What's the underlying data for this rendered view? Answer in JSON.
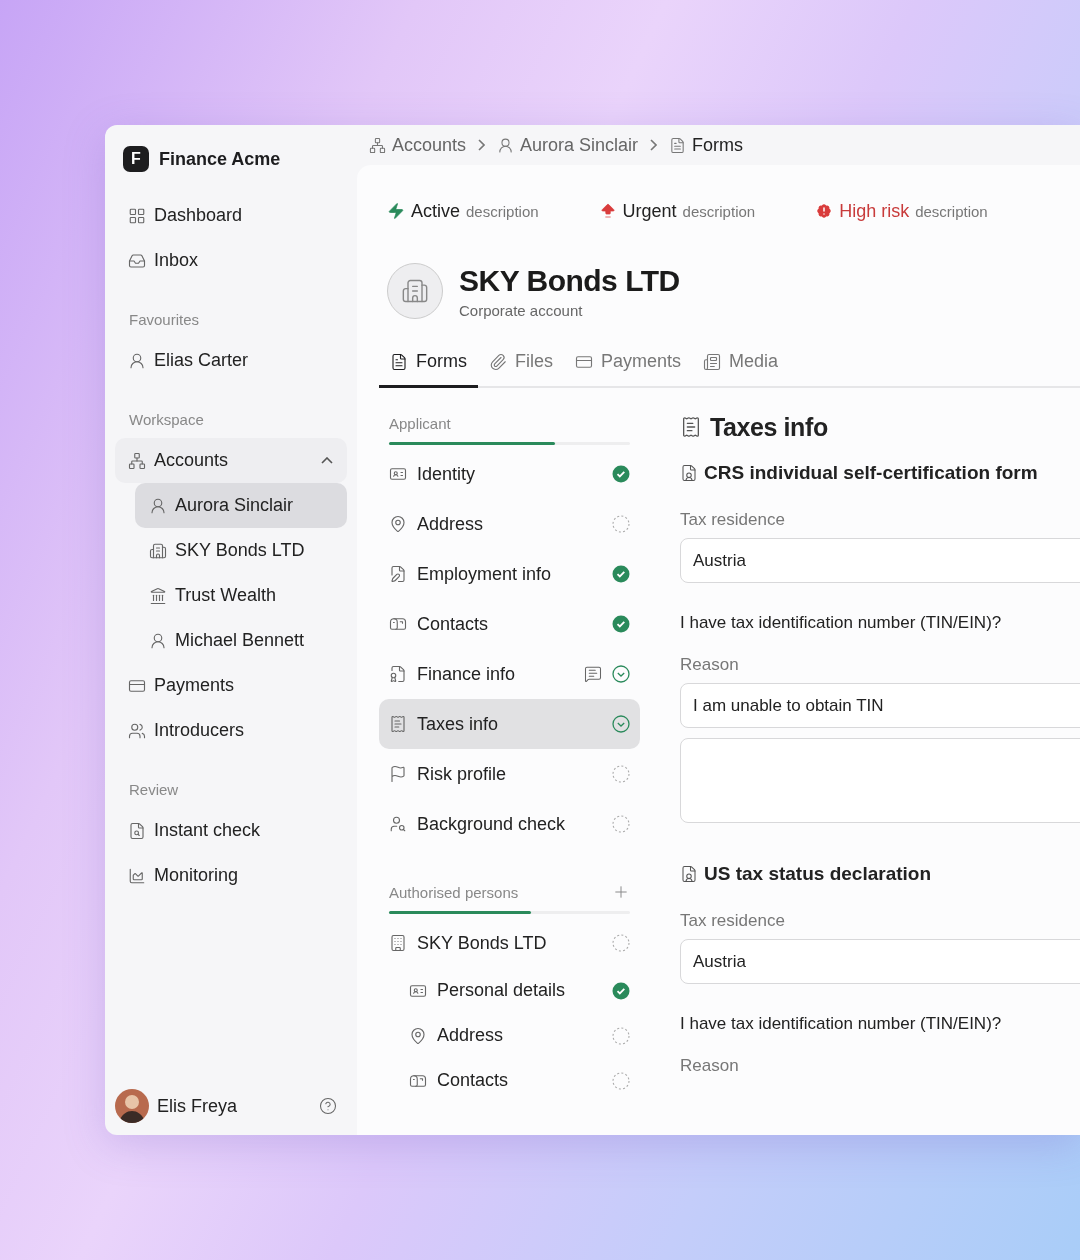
{
  "sidebar": {
    "brand": {
      "logo": "F",
      "name": "Finance Acme"
    },
    "items": [
      {
        "label": "Dashboard",
        "selected": false
      },
      {
        "label": "Inbox",
        "selected": false
      }
    ],
    "sections": [
      {
        "title": "Favourites",
        "items": [
          {
            "label": "Elias Carter",
            "selected": false
          }
        ]
      },
      {
        "title": "Workspace",
        "items": [
          {
            "label": "Accounts",
            "selected": false,
            "expanded": true,
            "children": [
              {
                "label": "Aurora Sinclair",
                "selected": true
              },
              {
                "label": "SKY Bonds LTD",
                "selected": false
              },
              {
                "label": "Trust Wealth",
                "selected": false
              },
              {
                "label": "Michael Bennett",
                "selected": false
              }
            ]
          },
          {
            "label": "Payments",
            "selected": false
          },
          {
            "label": "Introducers",
            "selected": false
          }
        ]
      },
      {
        "title": "Review",
        "items": [
          {
            "label": "Instant check",
            "selected": false
          },
          {
            "label": "Monitoring",
            "selected": false
          }
        ]
      }
    ],
    "user": {
      "name": "Elis Freya"
    }
  },
  "breadcrumbs": [
    {
      "label": "Accounts"
    },
    {
      "label": "Aurora Sinclair"
    },
    {
      "label": "Forms"
    }
  ],
  "statuses": [
    {
      "kind": "active",
      "label": "Active",
      "description": "description"
    },
    {
      "kind": "urgent",
      "label": "Urgent",
      "description": "description"
    },
    {
      "kind": "risk",
      "label": "High risk",
      "description": "description"
    }
  ],
  "account": {
    "name": "SKY Bonds LTD",
    "type": "Corporate account"
  },
  "tabs": [
    {
      "label": "Forms",
      "selected": true
    },
    {
      "label": "Files",
      "selected": false
    },
    {
      "label": "Payments",
      "selected": false
    },
    {
      "label": "Media",
      "selected": false
    }
  ],
  "form_nav": [
    {
      "title": "Applicant",
      "level": 0.69,
      "add": false,
      "items": [
        {
          "label": "Identity",
          "kind": "done",
          "selected": false
        },
        {
          "label": "Address",
          "kind": "pending",
          "selected": false
        },
        {
          "label": "Employment info",
          "kind": "done",
          "selected": false
        },
        {
          "label": "Contacts",
          "kind": "done",
          "selected": false
        },
        {
          "label": "Finance info",
          "kind": "review",
          "comment": true,
          "selected": false
        },
        {
          "label": "Taxes info",
          "kind": "review",
          "selected": true
        },
        {
          "label": "Risk profile",
          "kind": "pending",
          "selected": false
        },
        {
          "label": "Background check",
          "kind": "pending",
          "selected": false
        }
      ]
    },
    {
      "title": "Authorised persons",
      "level": 0.59,
      "add": true,
      "items": [
        {
          "label": "SKY Bonds LTD",
          "kind": "pending",
          "selected": false,
          "children": [
            {
              "label": "Personal details",
              "kind": "done",
              "selected": false
            },
            {
              "label": "Address",
              "kind": "pending",
              "selected": false
            },
            {
              "label": "Contacts",
              "kind": "pending",
              "selected": false
            }
          ]
        }
      ]
    }
  ],
  "form": {
    "title": "Taxes info",
    "sections": [
      {
        "title": "CRS individual self-certification form",
        "fields": [
          {
            "kind": "input",
            "label": "Tax residence",
            "value": "Austria"
          },
          {
            "kind": "question",
            "label": "I have tax identification number (TIN/EIN)?"
          },
          {
            "kind": "input",
            "label": "Reason",
            "value": "I am unable to obtain TIN"
          },
          {
            "kind": "textarea"
          }
        ]
      },
      {
        "title": "US tax status declaration",
        "fields": [
          {
            "kind": "input",
            "label": "Tax residence",
            "value": "Austria"
          },
          {
            "kind": "question",
            "label": "I have tax identification number (TIN/EIN)?"
          },
          {
            "kind": "label",
            "label": "Reason"
          }
        ]
      }
    ]
  }
}
